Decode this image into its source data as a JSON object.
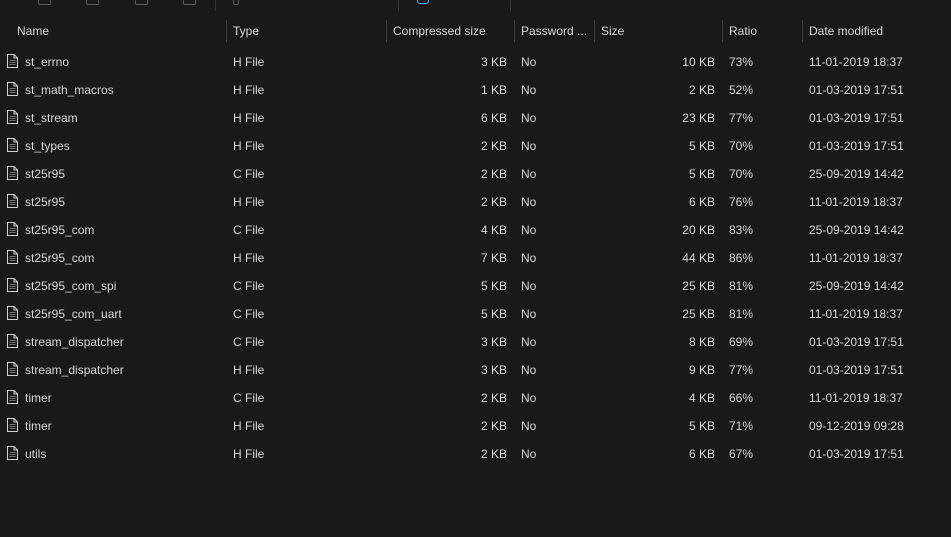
{
  "columns": {
    "name": "Name",
    "type": "Type",
    "compressed": "Compressed size",
    "password": "Password ...",
    "size": "Size",
    "ratio": "Ratio",
    "date": "Date modified"
  },
  "files": [
    {
      "name": "st_errno",
      "type": "H File",
      "compressed": "3 KB",
      "password": "No",
      "size": "10 KB",
      "ratio": "73%",
      "date": "11-01-2019 18:37"
    },
    {
      "name": "st_math_macros",
      "type": "H File",
      "compressed": "1 KB",
      "password": "No",
      "size": "2 KB",
      "ratio": "52%",
      "date": "01-03-2019 17:51"
    },
    {
      "name": "st_stream",
      "type": "H File",
      "compressed": "6 KB",
      "password": "No",
      "size": "23 KB",
      "ratio": "77%",
      "date": "01-03-2019 17:51"
    },
    {
      "name": "st_types",
      "type": "H File",
      "compressed": "2 KB",
      "password": "No",
      "size": "5 KB",
      "ratio": "70%",
      "date": "01-03-2019 17:51"
    },
    {
      "name": "st25r95",
      "type": "C File",
      "compressed": "2 KB",
      "password": "No",
      "size": "5 KB",
      "ratio": "70%",
      "date": "25-09-2019 14:42"
    },
    {
      "name": "st25r95",
      "type": "H File",
      "compressed": "2 KB",
      "password": "No",
      "size": "6 KB",
      "ratio": "76%",
      "date": "11-01-2019 18:37"
    },
    {
      "name": "st25r95_com",
      "type": "C File",
      "compressed": "4 KB",
      "password": "No",
      "size": "20 KB",
      "ratio": "83%",
      "date": "25-09-2019 14:42"
    },
    {
      "name": "st25r95_com",
      "type": "H File",
      "compressed": "7 KB",
      "password": "No",
      "size": "44 KB",
      "ratio": "86%",
      "date": "11-01-2019 18:37"
    },
    {
      "name": "st25r95_com_spi",
      "type": "C File",
      "compressed": "5 KB",
      "password": "No",
      "size": "25 KB",
      "ratio": "81%",
      "date": "25-09-2019 14:42"
    },
    {
      "name": "st25r95_com_uart",
      "type": "C File",
      "compressed": "5 KB",
      "password": "No",
      "size": "25 KB",
      "ratio": "81%",
      "date": "11-01-2019 18:37"
    },
    {
      "name": "stream_dispatcher",
      "type": "C File",
      "compressed": "3 KB",
      "password": "No",
      "size": "8 KB",
      "ratio": "69%",
      "date": "01-03-2019 17:51"
    },
    {
      "name": "stream_dispatcher",
      "type": "H File",
      "compressed": "3 KB",
      "password": "No",
      "size": "9 KB",
      "ratio": "77%",
      "date": "01-03-2019 17:51"
    },
    {
      "name": "timer",
      "type": "C File",
      "compressed": "2 KB",
      "password": "No",
      "size": "4 KB",
      "ratio": "66%",
      "date": "11-01-2019 18:37"
    },
    {
      "name": "timer",
      "type": "H File",
      "compressed": "2 KB",
      "password": "No",
      "size": "5 KB",
      "ratio": "71%",
      "date": "09-12-2019 09:28"
    },
    {
      "name": "utils",
      "type": "H File",
      "compressed": "2 KB",
      "password": "No",
      "size": "6 KB",
      "ratio": "67%",
      "date": "01-03-2019 17:51"
    }
  ],
  "icons": {
    "file": "file-icon",
    "sort": "sort-ascending-icon"
  },
  "colors": {
    "background": "#191919",
    "text": "#d8d8d8",
    "accent": "#4aa3ff"
  }
}
